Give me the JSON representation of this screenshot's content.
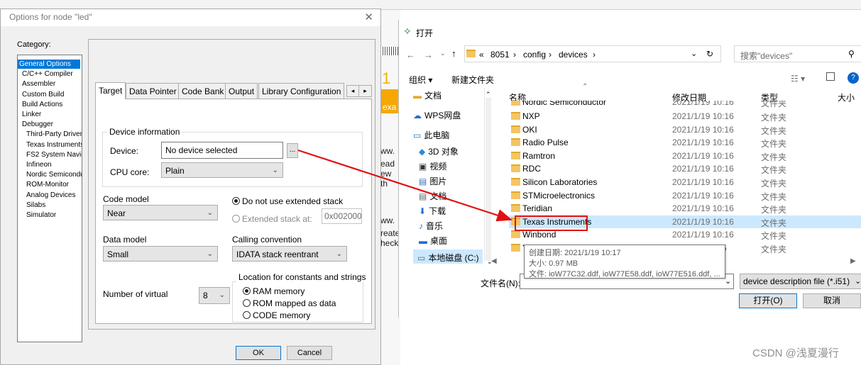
{
  "options_dialog": {
    "title": "Options for node \"led\"",
    "close_glyph": "✕",
    "category_label": "Category:",
    "categories": [
      {
        "label": "General Options",
        "selected": true,
        "indent": 0
      },
      {
        "label": "C/C++ Compiler",
        "selected": false,
        "indent": 1
      },
      {
        "label": "Assembler",
        "selected": false,
        "indent": 1
      },
      {
        "label": "Custom Build",
        "selected": false,
        "indent": 1
      },
      {
        "label": "Build Actions",
        "selected": false,
        "indent": 1
      },
      {
        "label": "Linker",
        "selected": false,
        "indent": 1
      },
      {
        "label": "Debugger",
        "selected": false,
        "indent": 1
      },
      {
        "label": "Third-Party Driver",
        "selected": false,
        "indent": 2
      },
      {
        "label": "Texas Instruments",
        "selected": false,
        "indent": 2
      },
      {
        "label": "FS2 System Naviga",
        "selected": false,
        "indent": 2
      },
      {
        "label": "Infineon",
        "selected": false,
        "indent": 2
      },
      {
        "label": "Nordic Semiconduc",
        "selected": false,
        "indent": 2
      },
      {
        "label": "ROM-Monitor",
        "selected": false,
        "indent": 2
      },
      {
        "label": "Analog Devices",
        "selected": false,
        "indent": 2
      },
      {
        "label": "Silabs",
        "selected": false,
        "indent": 2
      },
      {
        "label": "Simulator",
        "selected": false,
        "indent": 2
      }
    ],
    "tabs": [
      "Target",
      "Data Pointer",
      "Code Bank",
      "Output",
      "Library Configuration"
    ],
    "active_tab": "Target",
    "tab_scroll": {
      "left": "◂",
      "right": "▸"
    },
    "device_info_group": "Device information",
    "device_label": "Device:",
    "device_value": "No device selected",
    "browse_label": "...",
    "cpu_core_label": "CPU core:",
    "cpu_core_value": "Plain",
    "code_model_label": "Code model",
    "code_model_value": "Near",
    "extended_stack": {
      "off_label": "Do not use extended stack",
      "on_label": "Extended stack at:",
      "address": "0x002000",
      "selected": "off"
    },
    "data_model_label": "Data model",
    "data_model_value": "Small",
    "calling_convention_label": "Calling convention",
    "calling_convention_value": "IDATA stack reentrant",
    "location_group": "Location for constants and strings",
    "location_options": [
      "RAM memory",
      "ROM mapped as data",
      "CODE memory"
    ],
    "location_selected": 0,
    "num_virtual_label": "Number of virtual",
    "num_virtual_value": "8",
    "ok_label": "OK",
    "cancel_label": "Cancel"
  },
  "background_fragments": [
    "1",
    "exa",
    "ww.",
    "ead",
    "ew th",
    "ww.",
    "reate",
    "heck"
  ],
  "file_dialog": {
    "title": "打开",
    "breadcrumb": [
      "«",
      "8051",
      "›",
      "config",
      "›",
      "devices",
      "›"
    ],
    "search_placeholder": "搜索\"devices\"",
    "toolbar": {
      "organize": "组织 ▾",
      "new_folder": "新建文件夹",
      "view": "☷ ▾"
    },
    "nav_items": [
      {
        "label": "文档",
        "icon": "folder-icon"
      },
      {
        "label": "WPS网盘",
        "icon": "cloud-icon"
      },
      {
        "label": "此电脑",
        "icon": "computer-icon"
      },
      {
        "label": "3D 对象",
        "icon": "cube-icon"
      },
      {
        "label": "视频",
        "icon": "video-icon"
      },
      {
        "label": "图片",
        "icon": "picture-icon"
      },
      {
        "label": "文档",
        "icon": "document-icon"
      },
      {
        "label": "下载",
        "icon": "download-icon"
      },
      {
        "label": "音乐",
        "icon": "music-icon"
      },
      {
        "label": "桌面",
        "icon": "desktop-icon"
      },
      {
        "label": "本地磁盘 (C:)",
        "icon": "drive-icon"
      }
    ],
    "columns": {
      "name": "名称",
      "date": "修改日期",
      "type": "类型",
      "size": "大小"
    },
    "partial_top_row": {
      "name": "Nordic Semiconductor",
      "date": "2021/1/19 10:16",
      "type": "文件夹"
    },
    "rows": [
      {
        "name": "NXP",
        "date": "2021/1/19 10:16",
        "type": "文件夹",
        "selected": false
      },
      {
        "name": "OKI",
        "date": "2021/1/19 10:16",
        "type": "文件夹",
        "selected": false
      },
      {
        "name": "Radio Pulse",
        "date": "2021/1/19 10:16",
        "type": "文件夹",
        "selected": false
      },
      {
        "name": "Ramtron",
        "date": "2021/1/19 10:16",
        "type": "文件夹",
        "selected": false
      },
      {
        "name": "RDC",
        "date": "2021/1/19 10:16",
        "type": "文件夹",
        "selected": false
      },
      {
        "name": "Silicon Laboratories",
        "date": "2021/1/19 10:16",
        "type": "文件夹",
        "selected": false
      },
      {
        "name": "STMicroelectronics",
        "date": "2021/1/19 10:16",
        "type": "文件夹",
        "selected": false
      },
      {
        "name": "Teridian",
        "date": "2021/1/19 10:16",
        "type": "文件夹",
        "selected": false
      },
      {
        "name": "Texas Instruments",
        "date": "2021/1/19 10:16",
        "type": "文件夹",
        "selected": true
      },
      {
        "name": "Winbond",
        "date": "2021/1/19 10:16",
        "type": "文件夹",
        "selected": false
      },
      {
        "name": "Y",
        "date": "5",
        "type": "文件夹",
        "selected": false
      }
    ],
    "tooltip": [
      "创建日期: 2021/1/19 10:17",
      "大小: 0.97 MB",
      "文件: ioW77C32.ddf, ioW77E58.ddf, ioW77E516.ddf, ..."
    ],
    "filename_label": "文件名(N):",
    "filetype_value": "device description file (*.i51)",
    "open_label": "打开(O)",
    "cancel_label": "取消"
  },
  "watermark": "CSDN @浅夏漫行",
  "colors": {
    "selection": "#0078d7",
    "annotation": "#e11010",
    "folder": "#f4c563"
  }
}
